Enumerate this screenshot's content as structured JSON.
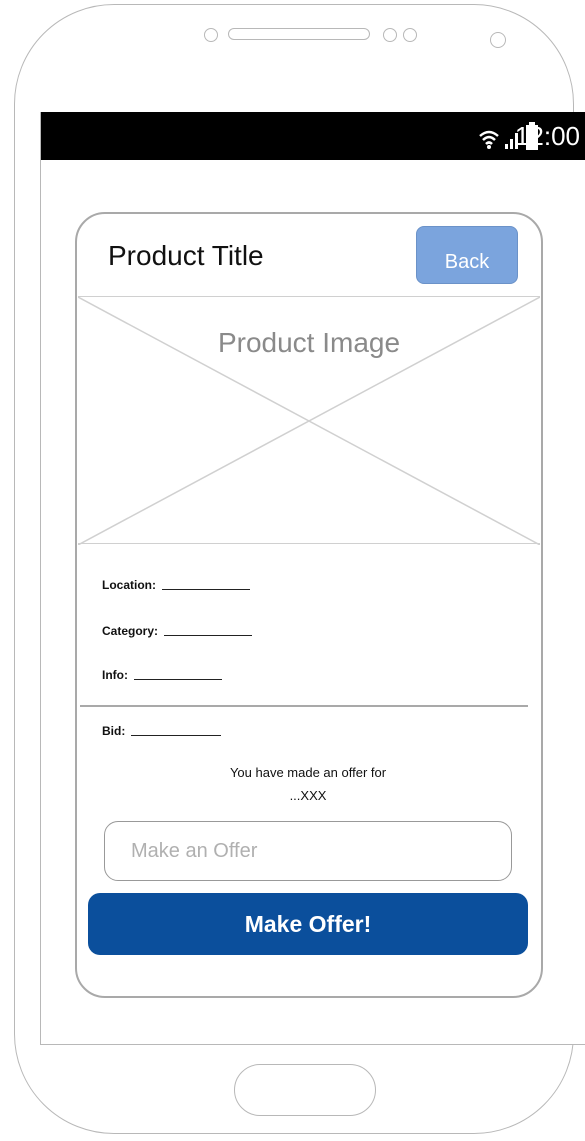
{
  "status_bar": {
    "time": "12:00",
    "icons": [
      "wifi-icon",
      "signal-icon",
      "battery-icon"
    ]
  },
  "product": {
    "title": "Product Title",
    "back_label": "Back",
    "image_label": "Product Image"
  },
  "details": {
    "location_label": "Location:",
    "category_label": "Category:",
    "info_label": "Info:",
    "bid_label": "Bid:"
  },
  "offer": {
    "note_line1": "You have made an offer for",
    "note_line2": "...XXX",
    "input_placeholder": "Make an Offer",
    "button_label": "Make Offer!"
  },
  "colors": {
    "back_button": "#7ba4dd",
    "primary_button": "#0b4f9c",
    "status_bar": "#000000"
  }
}
